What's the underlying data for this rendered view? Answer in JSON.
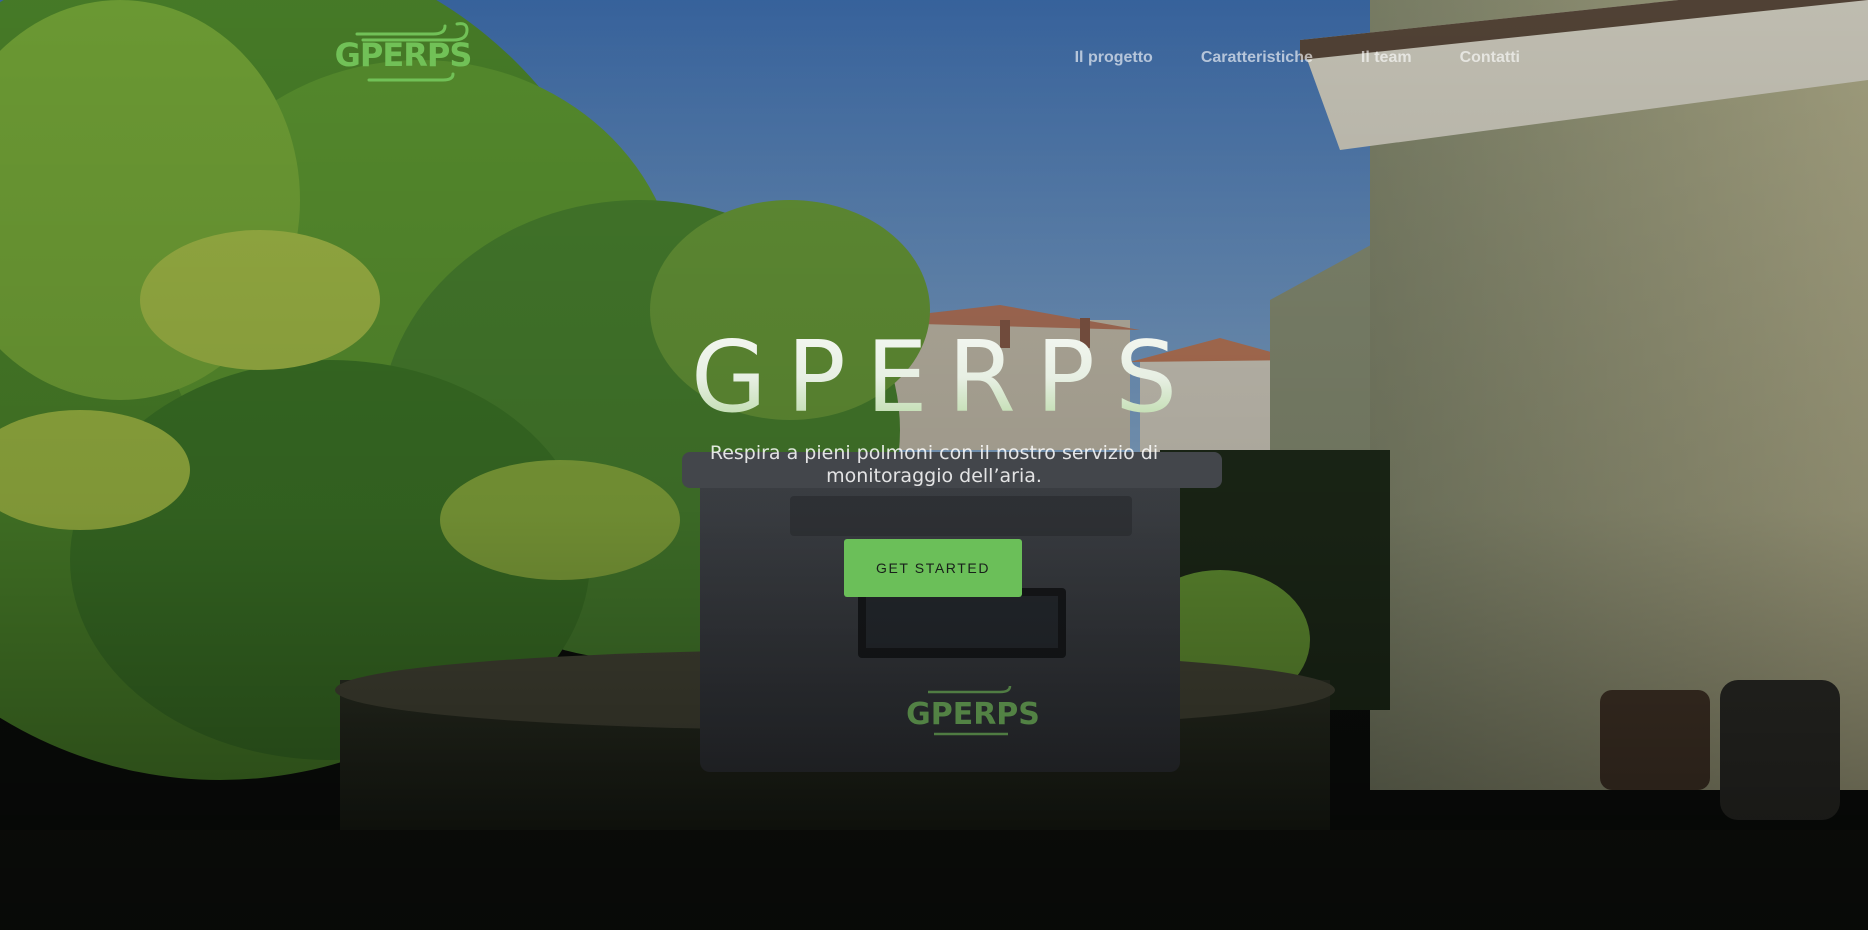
{
  "brand": {
    "logo_text": "GPERPS",
    "accent_color": "#71c157"
  },
  "nav": {
    "items": [
      {
        "label": "Il progetto"
      },
      {
        "label": "Caratteristiche"
      },
      {
        "label": "Il team"
      },
      {
        "label": "Contatti"
      }
    ]
  },
  "hero": {
    "title": "GPERPS",
    "subtitle": "Respira a pieni polmoni con il nostro servizio di monitoraggio dell’aria.",
    "cta_label": "GET STARTED",
    "cta_color": "#6bbf59",
    "device_logo_text": "GPERPS"
  }
}
